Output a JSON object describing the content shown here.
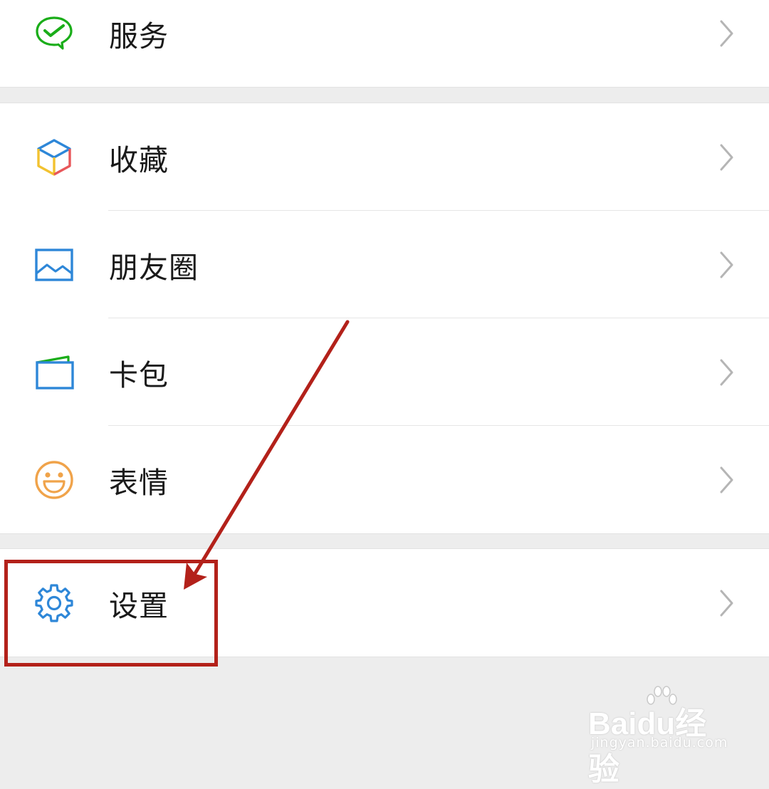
{
  "menu": {
    "services": {
      "label": "服务",
      "icon": "wechat-pay-icon"
    },
    "favorites": {
      "label": "收藏",
      "icon": "cube-icon"
    },
    "moments": {
      "label": "朋友圈",
      "icon": "picture-icon"
    },
    "cards": {
      "label": "卡包",
      "icon": "wallet-icon"
    },
    "stickers": {
      "label": "表情",
      "icon": "smile-icon"
    },
    "settings": {
      "label": "设置",
      "icon": "gear-icon"
    }
  },
  "colors": {
    "annotation": "#b3211a",
    "background": "#ededed",
    "green": "#1aad19",
    "blue": "#2e87d8",
    "orange": "#f0a34a"
  },
  "watermark": {
    "main": "Baidu经验",
    "sub": "jingyan.baidu.com"
  }
}
